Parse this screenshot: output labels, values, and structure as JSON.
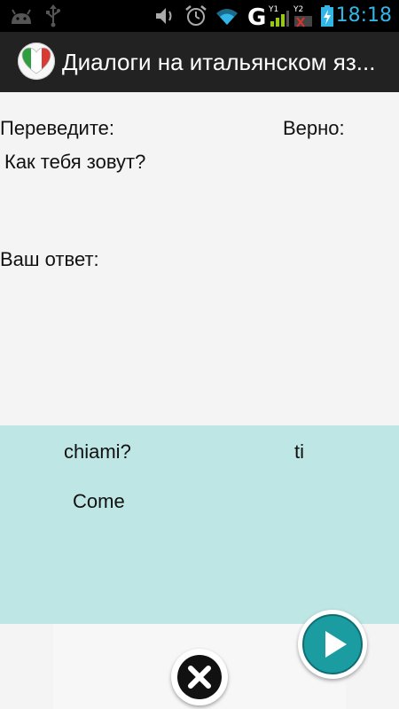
{
  "status_bar": {
    "time": "18:18",
    "icons": [
      "android-icon",
      "usb-icon",
      "vibrate-icon",
      "alarm-icon",
      "wifi-icon",
      "network-g-icon",
      "signal-1-icon",
      "signal-2-icon",
      "battery-charging-icon"
    ],
    "colors": {
      "accent": "#33b5e5",
      "charging": "#99cc00"
    }
  },
  "action_bar": {
    "title": "Диалоги на итальянском яз...",
    "icon": "italy-heart-icon"
  },
  "question": {
    "translate_label": "Переведите:",
    "correct_label": "Верно:",
    "prompt": "Как тебя зовут?",
    "answer_label": "Ваш ответ:",
    "answer_value": "",
    "correct_value": ""
  },
  "words": [
    {
      "text": "chiami?"
    },
    {
      "text": "ti"
    },
    {
      "text": "Come"
    }
  ],
  "controls": {
    "next_icon": "play-icon",
    "clear_icon": "close-icon"
  },
  "colors": {
    "word_area": "#bde6e4",
    "teal": "#1a9ca0",
    "action_bar": "#222222"
  }
}
